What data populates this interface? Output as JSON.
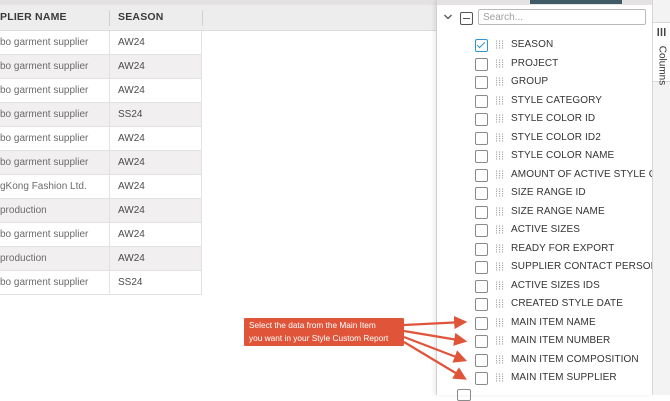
{
  "grid": {
    "headers": [
      "PLIER NAME",
      "SEASON"
    ],
    "rows": [
      {
        "supplier": "bo garment supplier",
        "season": "AW24"
      },
      {
        "supplier": "bo garment supplier",
        "season": "AW24"
      },
      {
        "supplier": "bo garment supplier",
        "season": "AW24"
      },
      {
        "supplier": "bo garment supplier",
        "season": "SS24"
      },
      {
        "supplier": "bo garment supplier",
        "season": "AW24"
      },
      {
        "supplier": "bo garment supplier",
        "season": "AW24"
      },
      {
        "supplier": "gKong Fashion Ltd.",
        "season": "AW24"
      },
      {
        "supplier": "production",
        "season": "AW24"
      },
      {
        "supplier": "bo garment supplier",
        "season": "AW24"
      },
      {
        "supplier": "production",
        "season": "AW24"
      },
      {
        "supplier": "bo garment supplier",
        "season": "SS24"
      }
    ]
  },
  "panel": {
    "search_placeholder": "Search...",
    "columns": [
      {
        "label": "SEASON",
        "checked": true
      },
      {
        "label": "PROJECT",
        "checked": false
      },
      {
        "label": "GROUP",
        "checked": false
      },
      {
        "label": "STYLE CATEGORY",
        "checked": false
      },
      {
        "label": "STYLE COLOR ID",
        "checked": false
      },
      {
        "label": "STYLE COLOR ID2",
        "checked": false
      },
      {
        "label": "STYLE COLOR NAME",
        "checked": false
      },
      {
        "label": "AMOUNT OF ACTIVE STYLE COLC",
        "checked": false
      },
      {
        "label": "SIZE RANGE ID",
        "checked": false
      },
      {
        "label": "SIZE RANGE NAME",
        "checked": false
      },
      {
        "label": "ACTIVE SIZES",
        "checked": false
      },
      {
        "label": "READY FOR EXPORT",
        "checked": false
      },
      {
        "label": "SUPPLIER CONTACT PERSON",
        "checked": false
      },
      {
        "label": "ACTIVE SIZES IDS",
        "checked": false
      },
      {
        "label": "CREATED STYLE DATE",
        "checked": false
      },
      {
        "label": "MAIN ITEM NAME",
        "checked": false
      },
      {
        "label": "MAIN ITEM NUMBER",
        "checked": false
      },
      {
        "label": "MAIN ITEM COMPOSITION",
        "checked": false
      },
      {
        "label": "MAIN ITEM SUPPLIER",
        "checked": false
      }
    ]
  },
  "sidebar": {
    "columns_tab_label": "Columns"
  },
  "annotation": {
    "line1": "Select the data from the Main Item",
    "line2": "you want in your Style Custom Report",
    "color": "#e0553a"
  },
  "colors": {
    "checkbox_accent": "#2f95d0",
    "header_bg": "#eeeded",
    "alt_row_bg": "#f1efef"
  }
}
